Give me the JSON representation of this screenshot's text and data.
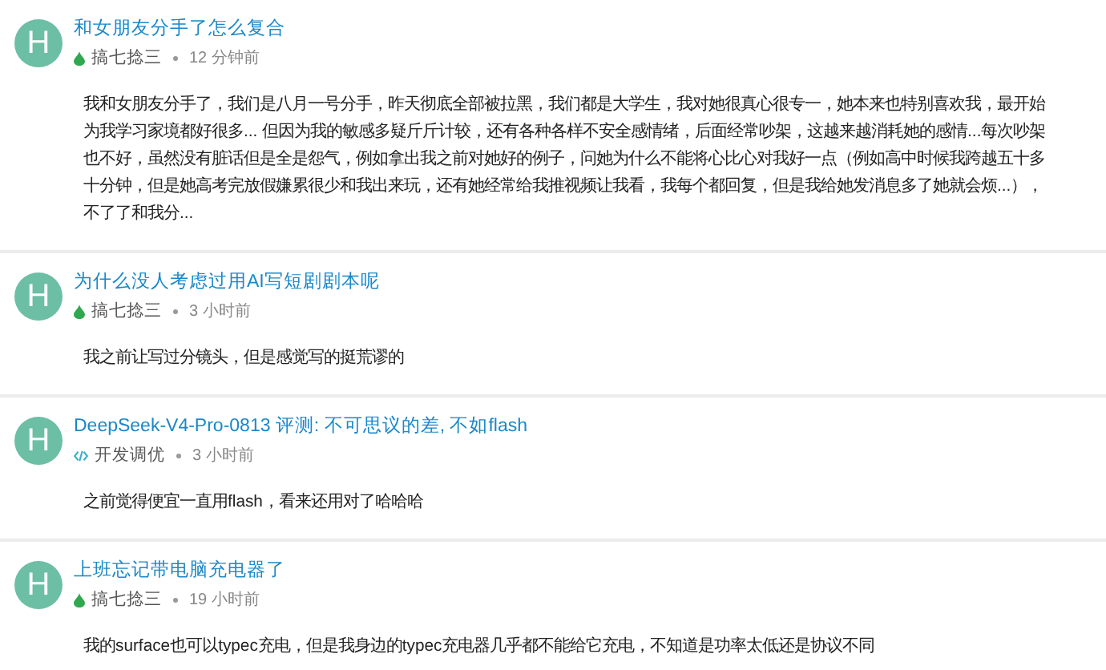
{
  "posts": [
    {
      "avatar_letter": "H",
      "title": "和女朋友分手了怎么复合",
      "category": {
        "kind": "drop",
        "name": "搞七捻三"
      },
      "time": "12 分钟前",
      "body": [
        "我和女朋友分手了，我们是八月一号分手，昨天彻底全部被拉黑，我们都是大学生，我对她很真心很专一，她本来也特别喜欢我，最开始",
        "为我学习家境都好很多... 但因为我的敏感多疑斤斤计较，还有各种各样不安全感情绪，后面经常吵架，这越来越消耗她的感情...每次吵架",
        "也不好，虽然没有脏话但是全是怨气，例如拿出我之前对她好的例子，问她为什么不能将心比心对我好一点（例如高中时候我跨越五十多",
        "十分钟，但是她高考完放假嫌累很少和我出来玩，还有她经常给我推视频让我看，我每个都回复，但是我给她发消息多了她就会烦...），",
        "不了了和我分..."
      ]
    },
    {
      "avatar_letter": "H",
      "title": "为什么没人考虑过用AI写短剧剧本呢",
      "category": {
        "kind": "drop",
        "name": "搞七捻三"
      },
      "time": "3 小时前",
      "body": [
        "我之前让写过分镜头，但是感觉写的挺荒谬的"
      ]
    },
    {
      "avatar_letter": "H",
      "title": "DeepSeek-V4-Pro-0813 评测: 不可思议的差, 不如flash",
      "category": {
        "kind": "code",
        "name": "开发调优"
      },
      "time": "3 小时前",
      "body": [
        "之前觉得便宜一直用flash，看来还用对了哈哈哈"
      ]
    },
    {
      "avatar_letter": "H",
      "title": "上班忘记带电脑充电器了",
      "category": {
        "kind": "drop",
        "name": "搞七捻三"
      },
      "time": "19 小时前",
      "body": [
        "我的surface也可以typec充电，但是我身边的typec充电器几乎都不能给它充电，不知道是功率太低还是协议不同"
      ]
    }
  ]
}
